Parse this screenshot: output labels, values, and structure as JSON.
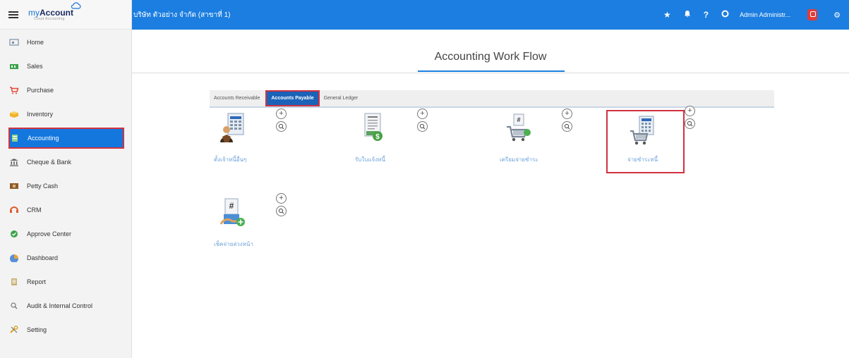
{
  "sidebar": {
    "brand": {
      "my": "my",
      "account": "Account",
      "sub": "Cloud Accounting"
    },
    "items": [
      {
        "label": "Home",
        "icon": "home-icon",
        "color": "#7b8fa8"
      },
      {
        "label": "Sales",
        "icon": "sales-icon",
        "color": "#3aa34a"
      },
      {
        "label": "Purchase",
        "icon": "cart-icon",
        "color": "#e14c3c"
      },
      {
        "label": "Inventory",
        "icon": "inventory-icon",
        "color": "#f0b429"
      },
      {
        "label": "Accounting",
        "icon": "accounting-icon",
        "color": "#3aa34a"
      },
      {
        "label": "Cheque & Bank",
        "icon": "bank-icon",
        "color": "#666666"
      },
      {
        "label": "Petty Cash",
        "icon": "cash-icon",
        "color": "#8e5a2b"
      },
      {
        "label": "CRM",
        "icon": "crm-icon",
        "color": "#e05a2a"
      },
      {
        "label": "Approve Center",
        "icon": "approve-icon",
        "color": "#3aa34a"
      },
      {
        "label": "Dashboard",
        "icon": "dashboard-icon",
        "color": "#5a8fd8"
      },
      {
        "label": "Report",
        "icon": "report-icon",
        "color": "#c9b27a"
      },
      {
        "label": "Audit & Internal Control",
        "icon": "audit-icon",
        "color": "#777777"
      },
      {
        "label": "Setting",
        "icon": "setting-icon",
        "color": "#d8a21e"
      }
    ],
    "active_index": 4
  },
  "header": {
    "company": "บริษัท ตัวอย่าง จำกัด (สาขาที่ 1)",
    "user": "Admin Administr...",
    "icons": [
      "star-icon",
      "bell-icon",
      "help-icon",
      "circle-icon",
      "notification-badge-icon",
      "gear-icon"
    ]
  },
  "main": {
    "title": "Accounting Work Flow",
    "tabs": [
      {
        "label": "Accounts Receivable",
        "active": false
      },
      {
        "label": "Accounts Payable",
        "active": true
      },
      {
        "label": "General Ledger",
        "active": false
      }
    ],
    "tiles": [
      {
        "label": "ตั้งเจ้าหนี้อื่นๆ",
        "icon": "creditor-icon",
        "highlight": false
      },
      {
        "label": "รับใบแจ้งหนี้",
        "icon": "invoice-receive-icon",
        "highlight": false
      },
      {
        "label": "เตรียมจ่ายชำระ",
        "icon": "prepare-payment-icon",
        "highlight": false
      },
      {
        "label": "จ่ายชำระหนี้",
        "icon": "payment-icon",
        "highlight": true
      },
      {
        "label": "เช็คจ่ายล่วงหน้า",
        "icon": "cheque-issue-icon",
        "highlight": false
      }
    ],
    "add_symbol": "+"
  },
  "colors": {
    "header": "#1b7ee0",
    "active_nav": "#1477de",
    "highlight_border": "#d0323f",
    "tile_label": "#6da2d8"
  }
}
